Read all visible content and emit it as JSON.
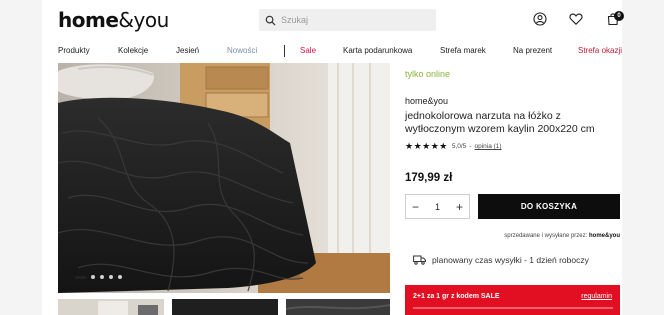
{
  "header": {
    "logo_main": "home",
    "logo_amp": "&",
    "logo_suffix": "you",
    "search_placeholder": "Szukaj",
    "cart_count": "0"
  },
  "nav": {
    "items": [
      {
        "label": "Produkty",
        "color": "#222222"
      },
      {
        "label": "Kolekcje",
        "color": "#222222"
      },
      {
        "label": "Jesień",
        "color": "#222222"
      },
      {
        "label": "Nowości",
        "color": "#7a8fa6"
      },
      {
        "label": "Sale",
        "color": "#d6134b"
      },
      {
        "label": "Karta podarunkowa",
        "color": "#222222"
      },
      {
        "label": "Strefa marek",
        "color": "#222222"
      },
      {
        "label": "Na prezent",
        "color": "#222222"
      },
      {
        "label": "Strefa okazji",
        "color": "#c0203a"
      }
    ]
  },
  "gallery": {
    "dot_count": 5,
    "active_dot": 0
  },
  "product": {
    "availability": "tylko online",
    "brand": "home&you",
    "title": "jednokolorowa narzuta na łóżko z wytłoczonym wzorem kaylin 200x220 cm",
    "stars": "★★★★★",
    "rating_value": "5,0/5",
    "reviews_link": "opinia (1)",
    "rating_separator": "-",
    "price": "179,99 zł",
    "quantity": "1",
    "qty_minus": "−",
    "qty_plus": "+",
    "add_to_cart": "DO KOSZYKA",
    "seller_prefix": "sprzedawane i wysyłane przez:",
    "seller_name": "home&you",
    "shipping": "planowany czas wysyłki - 1 dzień roboczy"
  },
  "promo": {
    "text": "2+1 za 1 gr z kodem SALE",
    "link": "regulamin",
    "color": "#e20f22"
  },
  "colors": {
    "accent_green": "#8db33a",
    "button_black": "#0d0d0d"
  }
}
